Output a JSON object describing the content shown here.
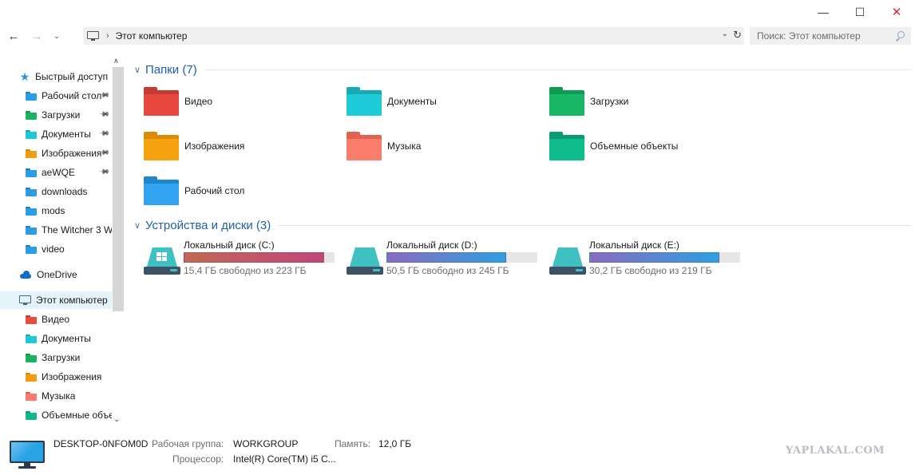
{
  "window_controls": {
    "minimize": "—",
    "maximize": "☐",
    "close": "✕"
  },
  "toolbar": {
    "back": "←",
    "forward": "→",
    "recent": "⌄",
    "path_separator": "›",
    "path": "Этот компьютер",
    "dropdown": "⌄",
    "refresh": "↻",
    "search_placeholder": "Поиск: Этот компьютер"
  },
  "sidebar": {
    "scroll_up": "∧",
    "scroll_down": "⌄",
    "items": [
      {
        "label": "Быстрый доступ",
        "icon": "star-icon",
        "level": 1
      },
      {
        "label": "Рабочий стол",
        "icon": "folder-icon",
        "color": "#2e9be6",
        "tab": "#1b7fc4",
        "level": 2,
        "pinned": true
      },
      {
        "label": "Загрузки",
        "icon": "folder-icon",
        "color": "#17b262",
        "tab": "#0f9550",
        "level": 2,
        "pinned": true
      },
      {
        "label": "Документы",
        "icon": "folder-icon",
        "color": "#1fc8d6",
        "tab": "#14a8b5",
        "level": 2,
        "pinned": true
      },
      {
        "label": "Изображения",
        "icon": "folder-icon",
        "color": "#f39c12",
        "tab": "#d9860a",
        "level": 2,
        "pinned": true
      },
      {
        "label": "aeWQE",
        "icon": "folder-icon",
        "color": "#2e9be6",
        "tab": "#1b7fc4",
        "level": 2,
        "pinned": true
      },
      {
        "label": "downloads",
        "icon": "folder-icon",
        "color": "#2e9be6",
        "tab": "#1b7fc4",
        "level": 2,
        "pinned": false
      },
      {
        "label": "mods",
        "icon": "folder-icon",
        "color": "#2e9be6",
        "tab": "#1b7fc4",
        "level": 2,
        "pinned": false
      },
      {
        "label": "The Witcher 3 W",
        "icon": "folder-icon",
        "color": "#2e9be6",
        "tab": "#1b7fc4",
        "level": 2,
        "pinned": false
      },
      {
        "label": "video",
        "icon": "folder-icon",
        "color": "#2e9be6",
        "tab": "#1b7fc4",
        "level": 2,
        "pinned": false
      },
      {
        "label": "OneDrive",
        "icon": "cloud-icon",
        "level": 1
      },
      {
        "label": "Этот компьютер",
        "icon": "computer-icon",
        "level": 1,
        "selected": true
      },
      {
        "label": "Видео",
        "icon": "folder-icon",
        "color": "#e74c3c",
        "tab": "#c0392b",
        "level": 2
      },
      {
        "label": "Документы",
        "icon": "folder-icon",
        "color": "#1fc8d6",
        "tab": "#14a8b5",
        "level": 2
      },
      {
        "label": "Загрузки",
        "icon": "folder-icon",
        "color": "#17b262",
        "tab": "#0f9550",
        "level": 2
      },
      {
        "label": "Изображения",
        "icon": "folder-icon",
        "color": "#f39c12",
        "tab": "#d9860a",
        "level": 2
      },
      {
        "label": "Музыка",
        "icon": "folder-icon",
        "color": "#fa7b6b",
        "tab": "#e0604f",
        "level": 2
      },
      {
        "label": "Объемные объекты",
        "icon": "folder-icon",
        "color": "#10b98a",
        "tab": "#0b9670",
        "level": 2
      }
    ]
  },
  "folders_group": {
    "title": "Папки (7)",
    "chevron": "∨",
    "items": [
      {
        "label": "Видео",
        "color": "#e8493f",
        "back": "#c73a31"
      },
      {
        "label": "Документы",
        "color": "#1fcbd9",
        "back": "#16aab7"
      },
      {
        "label": "Загрузки",
        "color": "#18b866",
        "back": "#109a53"
      },
      {
        "label": "Изображения",
        "color": "#f7a20f",
        "back": "#dc8a08"
      },
      {
        "label": "Музыка",
        "color": "#fa7d6c",
        "back": "#e3624f"
      },
      {
        "label": "Объемные объекты",
        "color": "#10bd8d",
        "back": "#0a9b72"
      },
      {
        "label": "Рабочий стол",
        "color": "#33a4f0",
        "back": "#1d86cf"
      }
    ]
  },
  "drives_group": {
    "title": "Устройства и диски (3)",
    "chevron": "∨",
    "items": [
      {
        "name": "Локальный диск (C:)",
        "free": "15,4 ГБ свободно из 223 ГБ",
        "used_fraction": 0.931,
        "gradient": [
          "#c06a55",
          "#c2457a"
        ],
        "windows_logo": true
      },
      {
        "name": "Локальный диск (D:)",
        "free": "50,5 ГБ свободно из 245 ГБ",
        "used_fraction": 0.794,
        "gradient": [
          "#8a6bbf",
          "#2f9fe0"
        ],
        "windows_logo": false
      },
      {
        "name": "Локальный диск (E:)",
        "free": "30,2 ГБ свободно из 219 ГБ",
        "used_fraction": 0.862,
        "gradient": [
          "#8a6bbf",
          "#2f9fe0"
        ],
        "windows_logo": false
      }
    ]
  },
  "details": {
    "computer_name": "DESKTOP-0NFOM0D",
    "workgroup_label": "Рабочая группа:",
    "workgroup_value": "WORKGROUP",
    "memory_label": "Память:",
    "memory_value": "12,0 ГБ",
    "cpu_label": "Процессор:",
    "cpu_value": "Intel(R) Core(TM) i5 C..."
  },
  "watermark": "YAPLAKAL.COM"
}
